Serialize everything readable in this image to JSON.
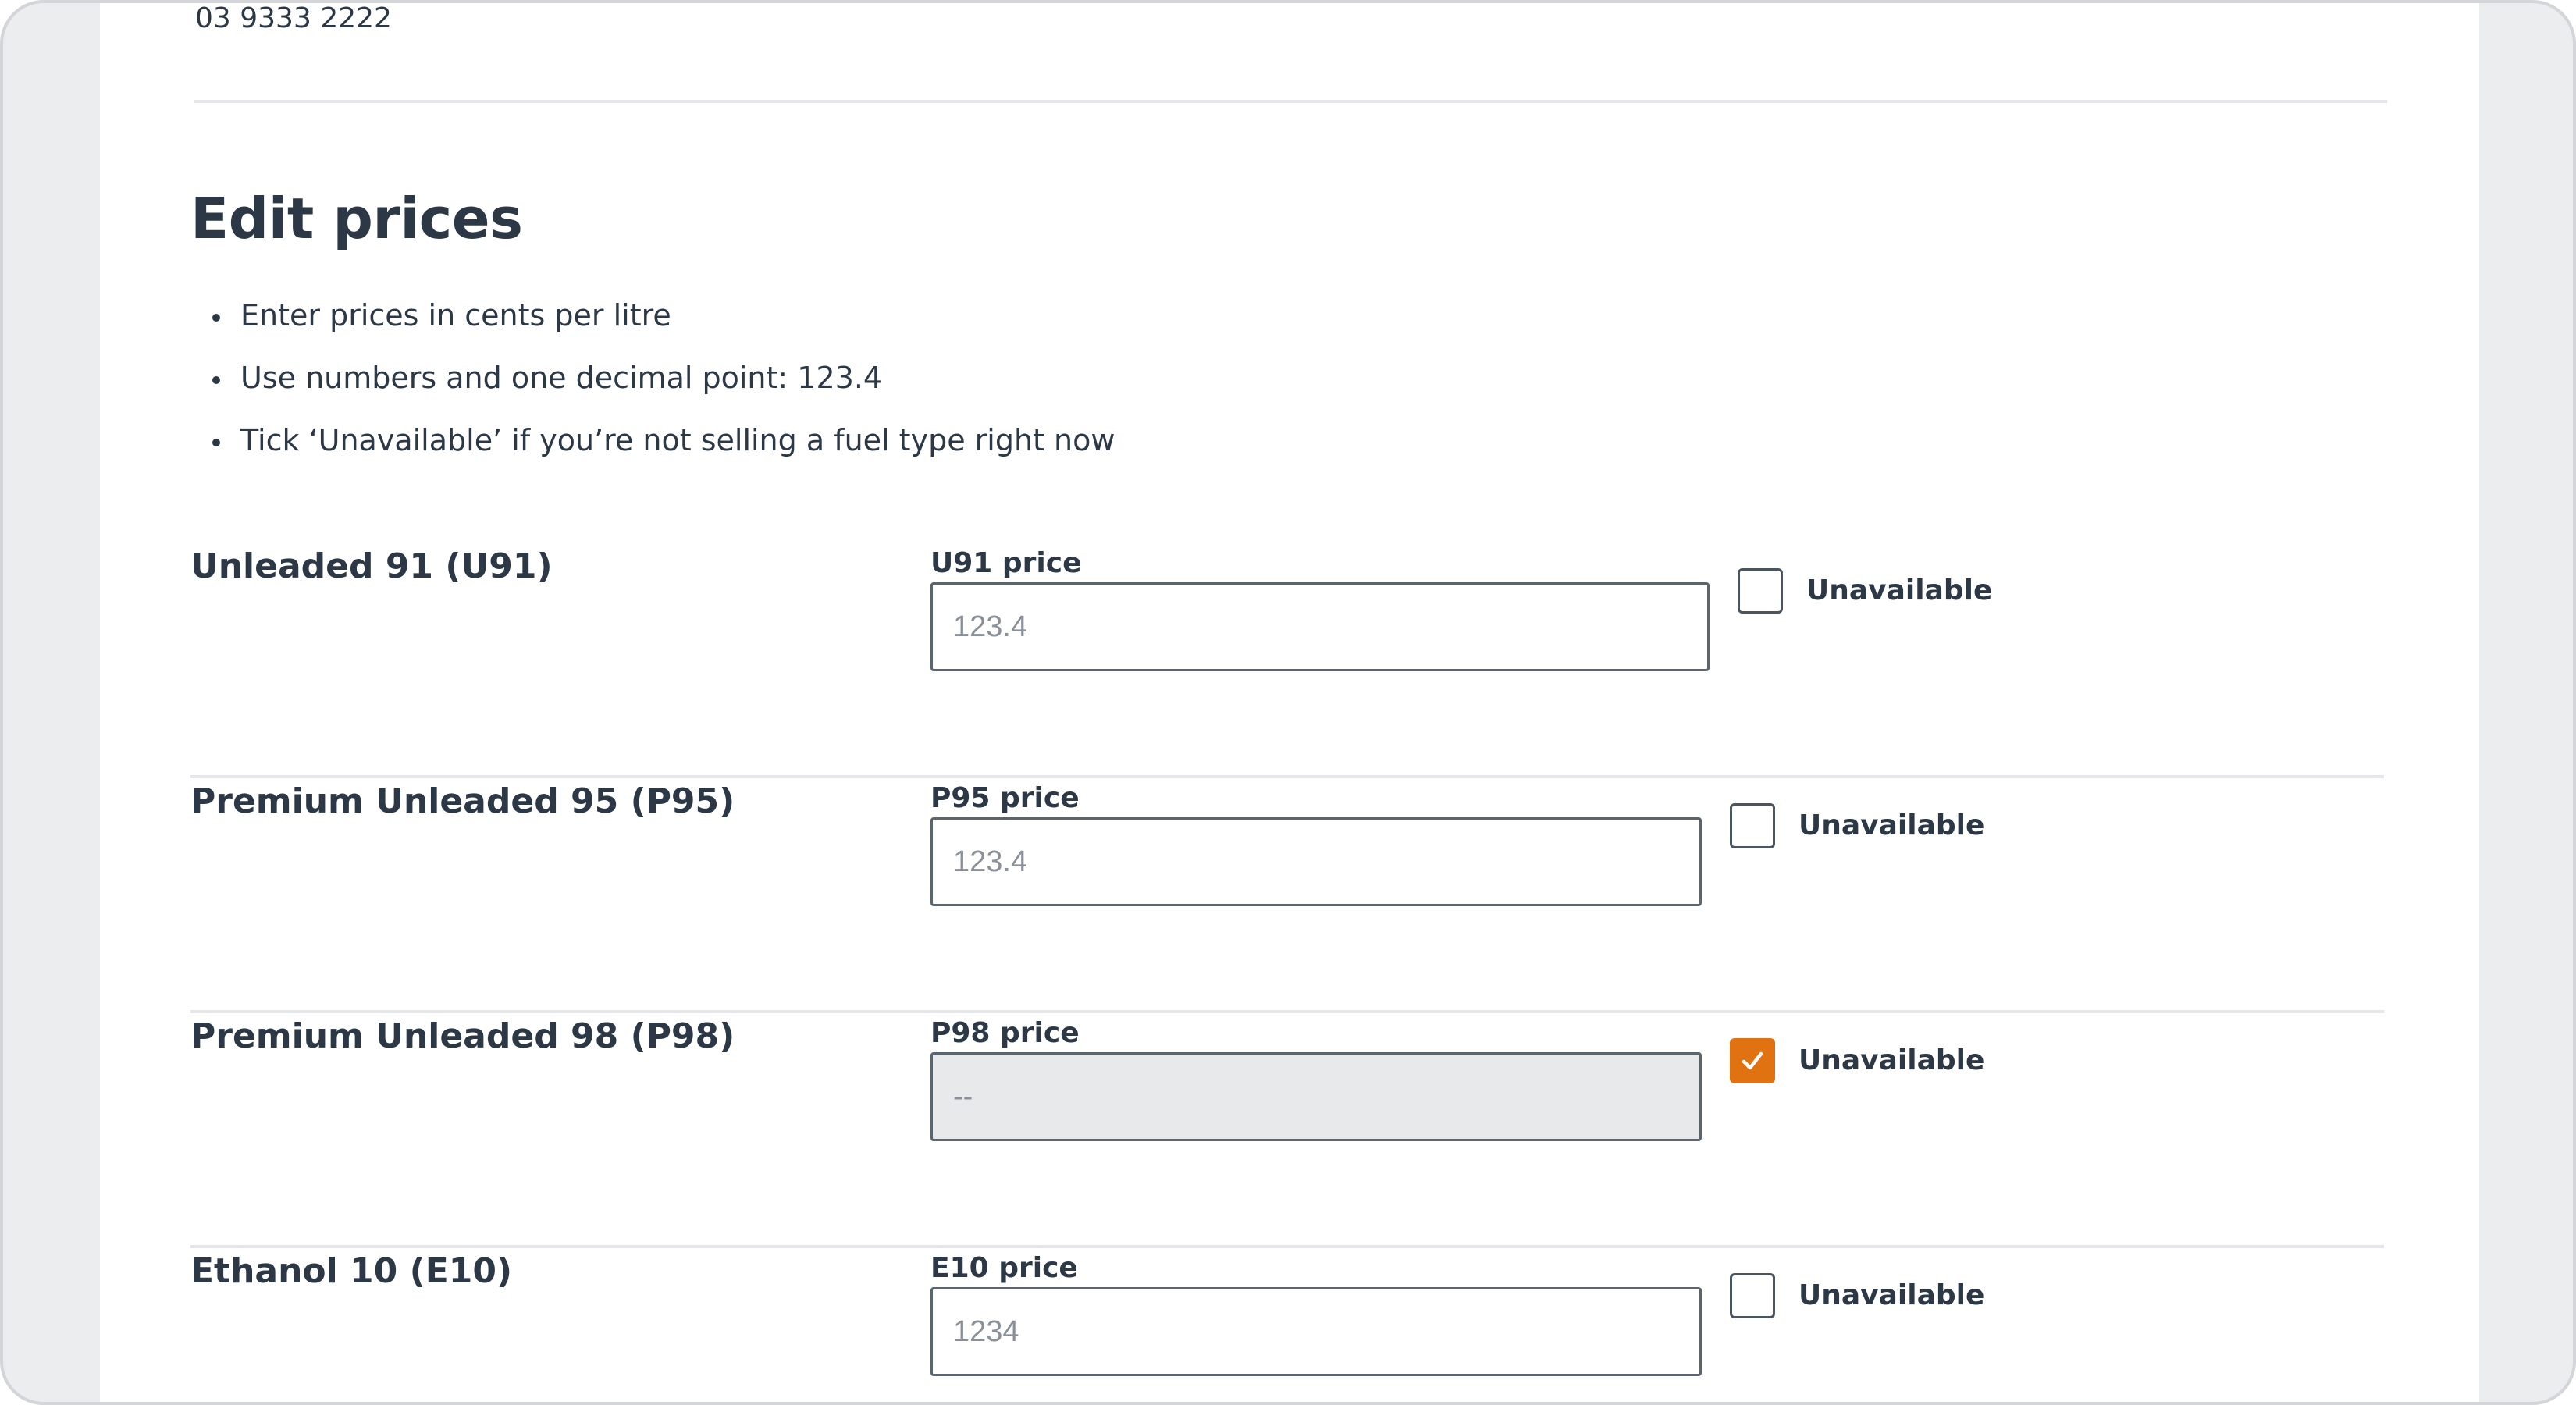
{
  "contact": {
    "phone": "03 9333 2222"
  },
  "page": {
    "heading": "Edit prices",
    "instructions": [
      "Enter prices in cents per litre",
      "Use numbers and one decimal point: 123.4",
      "Tick ‘Unavailable’ if you’re not selling a fuel type right now"
    ]
  },
  "fuels": [
    {
      "name": "Unleaded 91 (U91)",
      "price_label": "U91 price",
      "placeholder": "123.4",
      "unavailable_label": "Unavailable",
      "unavailable": false
    },
    {
      "name": "Premium Unleaded 95 (P95)",
      "price_label": "P95 price",
      "placeholder": "123.4",
      "unavailable_label": "Unavailable",
      "unavailable": false
    },
    {
      "name": "Premium Unleaded 98 (P98)",
      "price_label": "P98 price",
      "placeholder": "--",
      "unavailable_label": "Unavailable",
      "unavailable": true
    },
    {
      "name": "Ethanol 10 (E10)",
      "price_label": "E10 price",
      "placeholder": "1234",
      "unavailable_label": "Unavailable",
      "unavailable": false
    }
  ],
  "colors": {
    "accent": "#e07211",
    "text": "#2c3845",
    "disabled_bg": "#e8e9eb"
  }
}
